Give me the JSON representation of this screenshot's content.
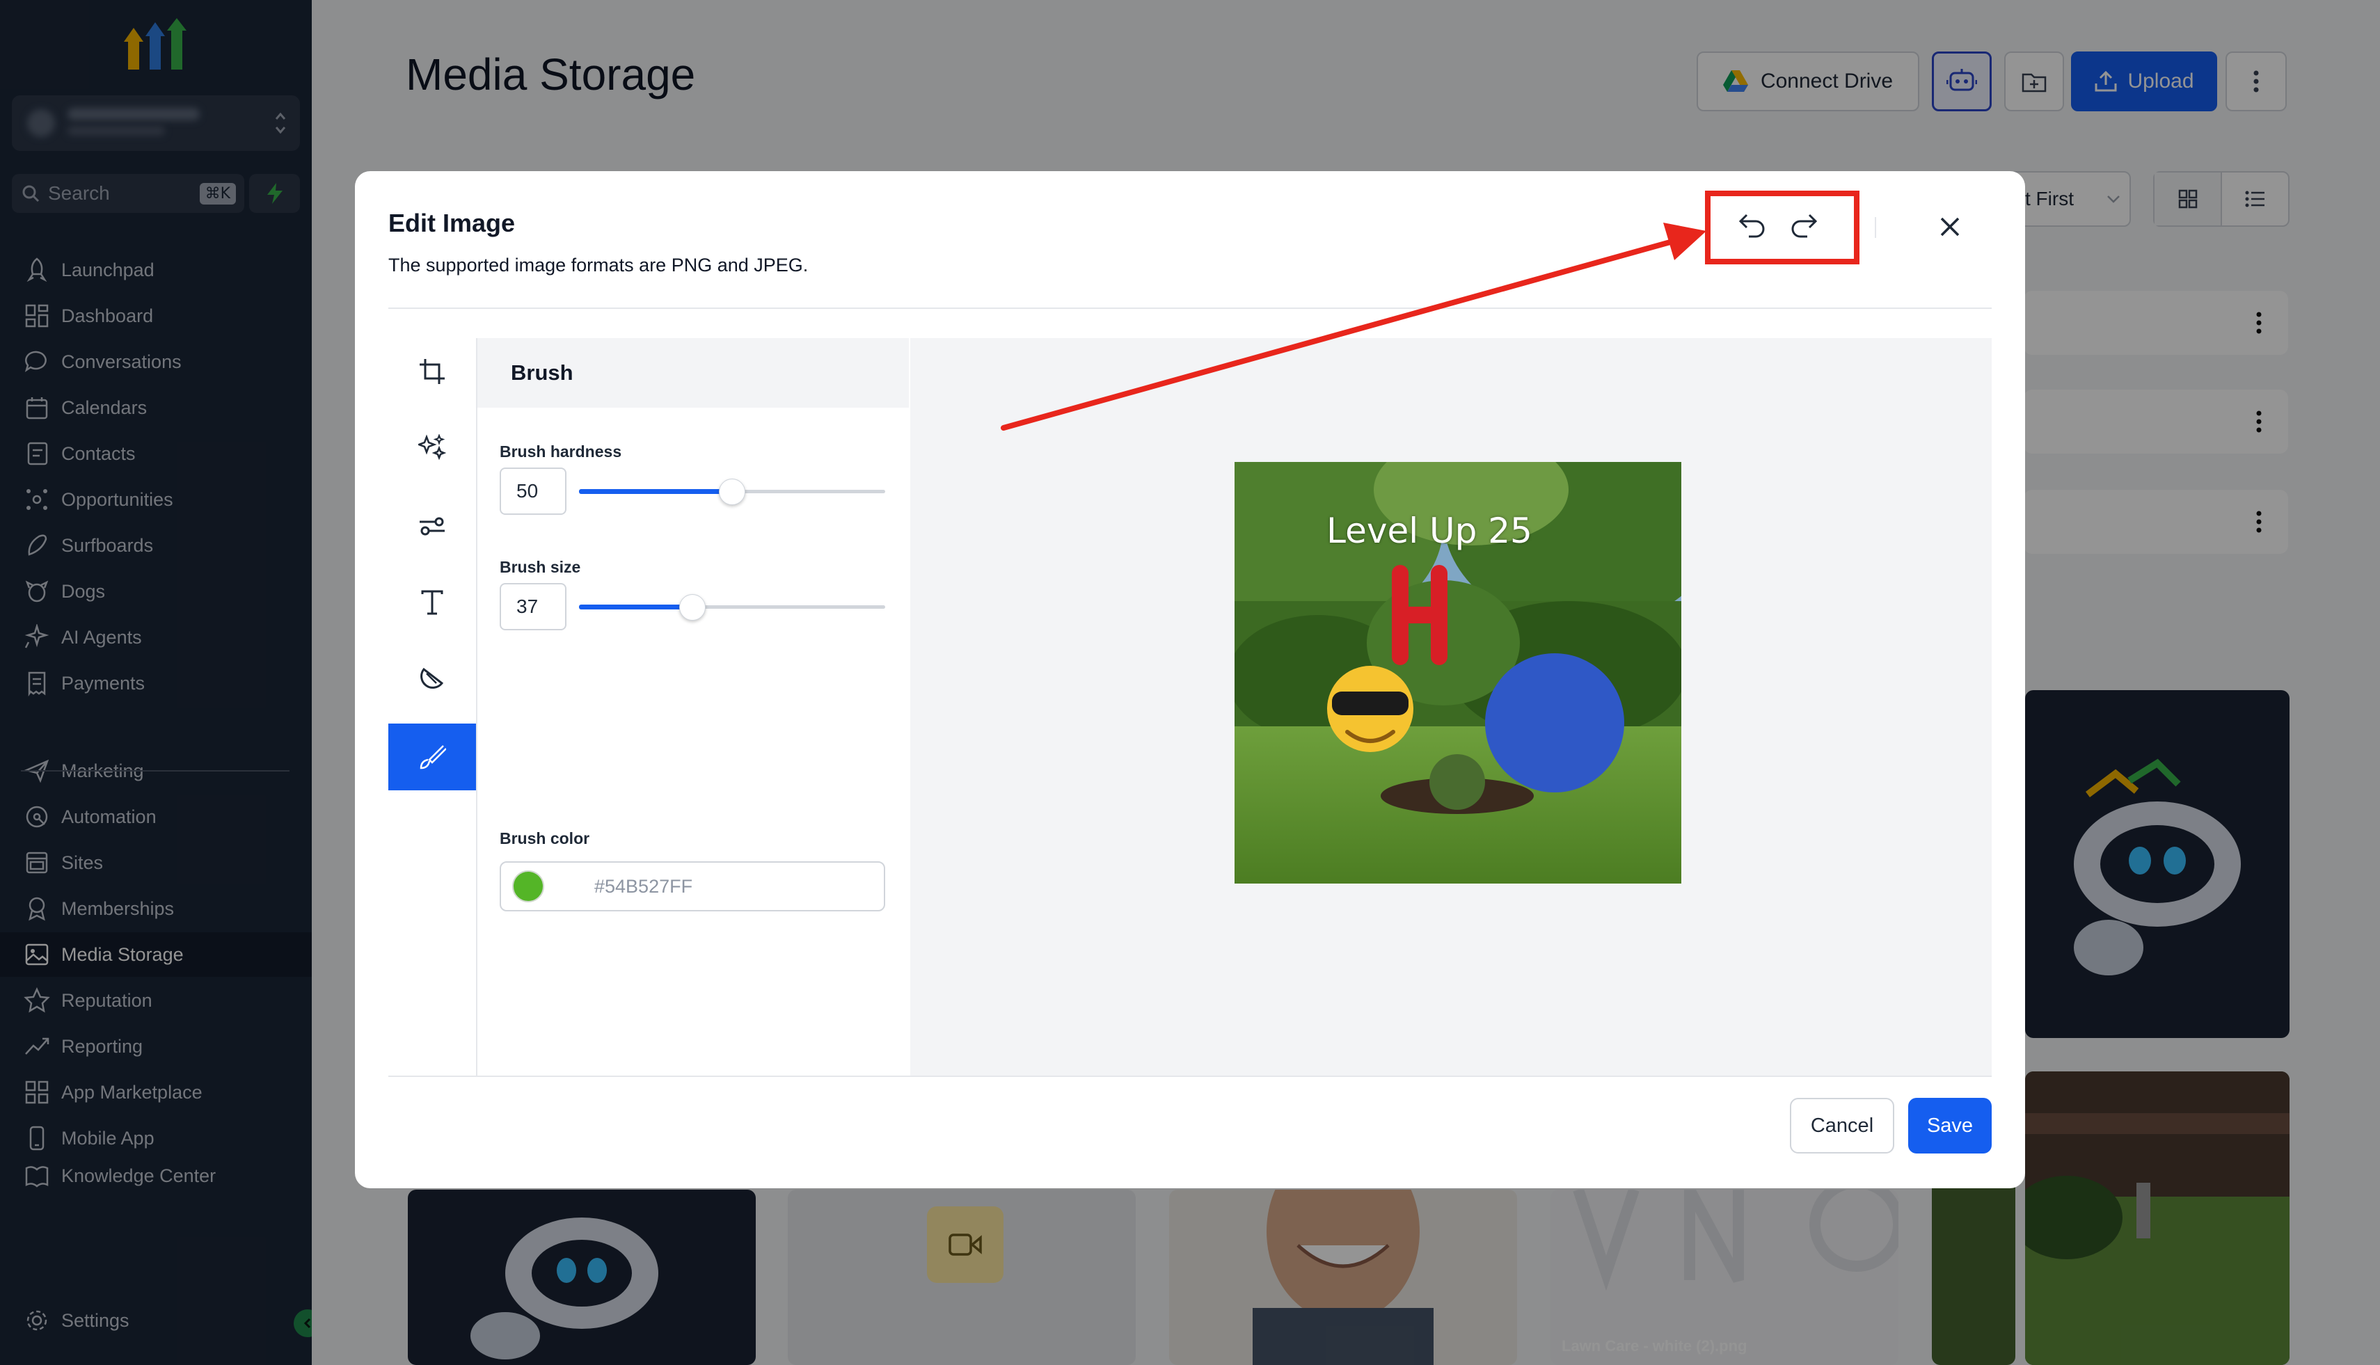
{
  "sidebar": {
    "search": {
      "label": "Search",
      "shortcut": "⌘K"
    },
    "nav": [
      {
        "label": "Launchpad",
        "icon": "rocket-icon"
      },
      {
        "label": "Dashboard",
        "icon": "dashboard-icon"
      },
      {
        "label": "Conversations",
        "icon": "chat-icon"
      },
      {
        "label": "Calendars",
        "icon": "calendar-icon"
      },
      {
        "label": "Contacts",
        "icon": "contacts-icon"
      },
      {
        "label": "Opportunities",
        "icon": "opportunities-icon"
      },
      {
        "label": "Surfboards",
        "icon": "surfboard-icon"
      },
      {
        "label": "Dogs",
        "icon": "dog-icon"
      },
      {
        "label": "AI Agents",
        "icon": "sparkle-icon"
      },
      {
        "label": "Payments",
        "icon": "receipt-icon"
      },
      {
        "label": "Marketing",
        "icon": "send-icon"
      },
      {
        "label": "Automation",
        "icon": "automation-icon"
      },
      {
        "label": "Sites",
        "icon": "sites-icon"
      },
      {
        "label": "Memberships",
        "icon": "badge-icon"
      },
      {
        "label": "Media Storage",
        "icon": "image-icon",
        "active": true
      },
      {
        "label": "Reputation",
        "icon": "star-icon"
      },
      {
        "label": "Reporting",
        "icon": "trend-icon"
      },
      {
        "label": "App Marketplace",
        "icon": "grid-icon"
      },
      {
        "label": "Mobile App",
        "icon": "phone-icon"
      },
      {
        "label": "Knowledge Center",
        "icon": "book-icon"
      }
    ],
    "settings_label": "Settings"
  },
  "header": {
    "title": "Media Storage",
    "connect_drive": "Connect Drive",
    "upload": "Upload",
    "sort_label": "t First"
  },
  "tiles": {
    "lawn_care_label": "Lawn Care - white (2).png"
  },
  "modal": {
    "title": "Edit Image",
    "subtitle": "The supported image formats are PNG and JPEG.",
    "panel": {
      "title": "Brush",
      "hardness_label": "Brush hardness",
      "hardness_value": "50",
      "hardness_level": 0.5,
      "size_label": "Brush size",
      "size_value": "37",
      "size_level": 0.37,
      "color_label": "Brush color",
      "color_value": "#54B527FF",
      "color_swatch": "#54b527"
    },
    "image_overlay_text": "Level Up 25",
    "cancel": "Cancel",
    "save": "Save"
  },
  "colors": {
    "accent": "#155eef",
    "sidebar_bg": "#1b2637",
    "highlight": "#e8261c"
  }
}
